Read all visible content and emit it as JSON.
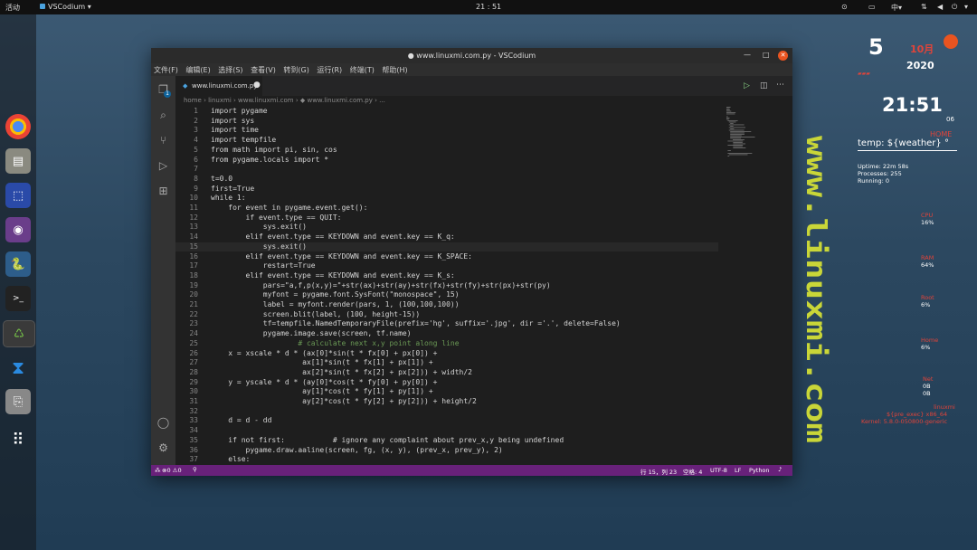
{
  "topbar": {
    "activities": "活动",
    "app_name": "VSCodium ▾",
    "clock": "21 : 51",
    "input_method": "中▾"
  },
  "window": {
    "title": "● www.linuxmi.com.py - VSCodium",
    "menu": [
      "文件(F)",
      "编辑(E)",
      "选择(S)",
      "查看(V)",
      "转到(G)",
      "运行(R)",
      "终端(T)",
      "帮助(H)"
    ],
    "tab_label": "www.linuxmi.com.py",
    "breadcrumb": "home › linuxmi › www.linuxmi.com › ◆ www.linuxmi.com.py › ...",
    "activity_badge": "1"
  },
  "code_lines": [
    {
      "n": "1",
      "text": "import pygame"
    },
    {
      "n": "2",
      "text": "import sys"
    },
    {
      "n": "3",
      "text": "import time"
    },
    {
      "n": "4",
      "text": "import tempfile"
    },
    {
      "n": "5",
      "text": "from math import pi, sin, cos"
    },
    {
      "n": "6",
      "text": "from pygame.locals import *"
    },
    {
      "n": "7",
      "text": ""
    },
    {
      "n": "8",
      "text": "t=0.0"
    },
    {
      "n": "9",
      "text": "first=True"
    },
    {
      "n": "10",
      "text": "while 1:"
    },
    {
      "n": "11",
      "text": "    for event in pygame.event.get():"
    },
    {
      "n": "12",
      "text": "        if event.type == QUIT:"
    },
    {
      "n": "13",
      "text": "            sys.exit()"
    },
    {
      "n": "14",
      "text": "        elif event.type == KEYDOWN and event.key == K_q:"
    },
    {
      "n": "15",
      "text": "            sys.exit()"
    },
    {
      "n": "16",
      "text": "        elif event.type == KEYDOWN and event.key == K_SPACE:"
    },
    {
      "n": "17",
      "text": "            restart=True"
    },
    {
      "n": "18",
      "text": "        elif event.type == KEYDOWN and event.key == K_s:"
    },
    {
      "n": "19",
      "text": "            pars=\"a,f,p(x,y)=\"+str(ax)+str(ay)+str(fx)+str(fy)+str(px)+str(py)"
    },
    {
      "n": "20",
      "text": "            myfont = pygame.font.SysFont(\"monospace\", 15)"
    },
    {
      "n": "21",
      "text": "            label = myfont.render(pars, 1, (100,100,100))"
    },
    {
      "n": "22",
      "text": "            screen.blit(label, (100, height-15))"
    },
    {
      "n": "23",
      "text": "            tf=tempfile.NamedTemporaryFile(prefix='hg', suffix='.jpg', dir ='.', delete=False)"
    },
    {
      "n": "24",
      "text": "            pygame.image.save(screen, tf.name)"
    },
    {
      "n": "25",
      "text": "                    # calculate next x,y point along line"
    },
    {
      "n": "26",
      "text": "    x = xscale * d * (ax[0]*sin(t * fx[0] + px[0]) +"
    },
    {
      "n": "27",
      "text": "                     ax[1]*sin(t * fx[1] + px[1]) +"
    },
    {
      "n": "28",
      "text": "                     ax[2]*sin(t * fx[2] + px[2])) + width/2"
    },
    {
      "n": "29",
      "text": "    y = yscale * d * (ay[0]*cos(t * fy[0] + py[0]) +"
    },
    {
      "n": "30",
      "text": "                     ay[1]*cos(t * fy[1] + py[1]) +"
    },
    {
      "n": "31",
      "text": "                     ay[2]*cos(t * fy[2] + py[2])) + height/2"
    },
    {
      "n": "32",
      "text": ""
    },
    {
      "n": "33",
      "text": "    d = d - dd"
    },
    {
      "n": "34",
      "text": ""
    },
    {
      "n": "35",
      "text": "    if not first:           # ignore any complaint about prev_x,y being undefined"
    },
    {
      "n": "36",
      "text": "        pygame.draw.aaline(screen, fg, (x, y), (prev_x, prev_y), 2)"
    },
    {
      "n": "37",
      "text": "    else:"
    }
  ],
  "status": {
    "problems": "⊗0 ⚠0",
    "position": "行 15，列 23",
    "spaces": "空格: 4",
    "encoding": "UTF-8",
    "eol": "LF",
    "language": "Python"
  },
  "conky": {
    "day": "5",
    "month": "10月",
    "year": "2020",
    "time": "21:51",
    "seconds": "06",
    "home_label": "HOME",
    "weather": "temp: ${weather} °",
    "uptime": "Uptime: 22m 58s",
    "processes": "Processes: 255",
    "running": "Running: 0",
    "cpu_label": "CPU",
    "cpu_val": "16%",
    "ram_label": "RAM",
    "ram_val": "64%",
    "root_label": "Root",
    "root_val": "6%",
    "home2_label": "Home",
    "home2_val": "6%",
    "net_label": "Net",
    "net_down": "0B",
    "net_up": "0B",
    "user": "linuxmi",
    "exec_line": "${pre_exec} x86_64",
    "kernel": "Kernel: 5.8.0-050800-generic"
  },
  "watermark_text": "www.linuxmi.com",
  "colors": {
    "keyword": "#c586c0",
    "string": "#ce9178",
    "comment": "#6a9955",
    "constant": "#569cd6",
    "statusbar": "#68217a",
    "watermark": "#c9d638",
    "conky_accent": "#e0443a"
  }
}
